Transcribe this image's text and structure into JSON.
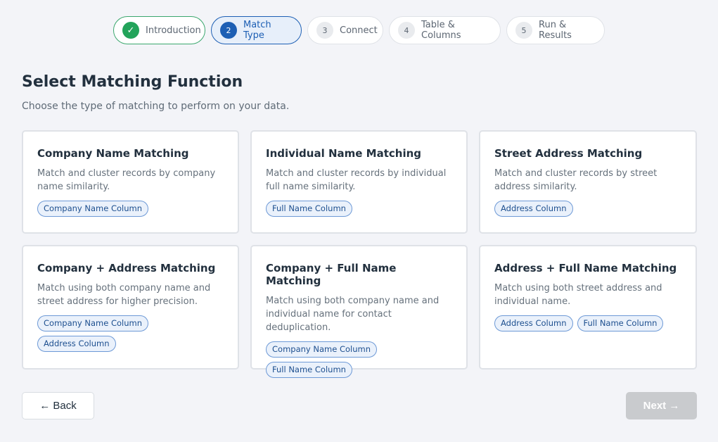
{
  "stepper": {
    "steps": [
      {
        "marker": "✓",
        "label": "Introduction",
        "state": "done"
      },
      {
        "marker": "2",
        "label": "Match Type",
        "state": "active"
      },
      {
        "marker": "3",
        "label": "Connect",
        "state": "pending"
      },
      {
        "marker": "4",
        "label": "Table & Columns",
        "state": "pending"
      },
      {
        "marker": "5",
        "label": "Run & Results",
        "state": "pending"
      }
    ]
  },
  "page": {
    "title": "Select Matching Function",
    "subtitle": "Choose the type of matching to perform on your data."
  },
  "cards": [
    {
      "title": "Company Name Matching",
      "description": "Match and cluster records by company name similarity.",
      "tags": [
        "Company Name Column"
      ]
    },
    {
      "title": "Individual Name Matching",
      "description": "Match and cluster records by individual full name similarity.",
      "tags": [
        "Full Name Column"
      ]
    },
    {
      "title": "Street Address Matching",
      "description": "Match and cluster records by street address similarity.",
      "tags": [
        "Address Column"
      ]
    },
    {
      "title": "Company + Address Matching",
      "description": "Match using both company name and street address for higher precision.",
      "tags": [
        "Company Name Column",
        "Address Column"
      ]
    },
    {
      "title": "Company + Full Name Matching",
      "description": "Match using both company name and individual name for contact deduplication.",
      "tags": [
        "Company Name Column",
        "Full Name Column"
      ]
    },
    {
      "title": "Address + Full Name Matching",
      "description": "Match using both street address and individual name.",
      "tags": [
        "Address Column",
        "Full Name Column"
      ]
    }
  ],
  "footer": {
    "back_label": "← Back",
    "next_label": "Next →",
    "next_disabled": true
  },
  "colors": {
    "accent": "#1d5fb4",
    "success": "#22a35a",
    "background": "#f3f4f8",
    "disabled": "#c9cbce"
  }
}
